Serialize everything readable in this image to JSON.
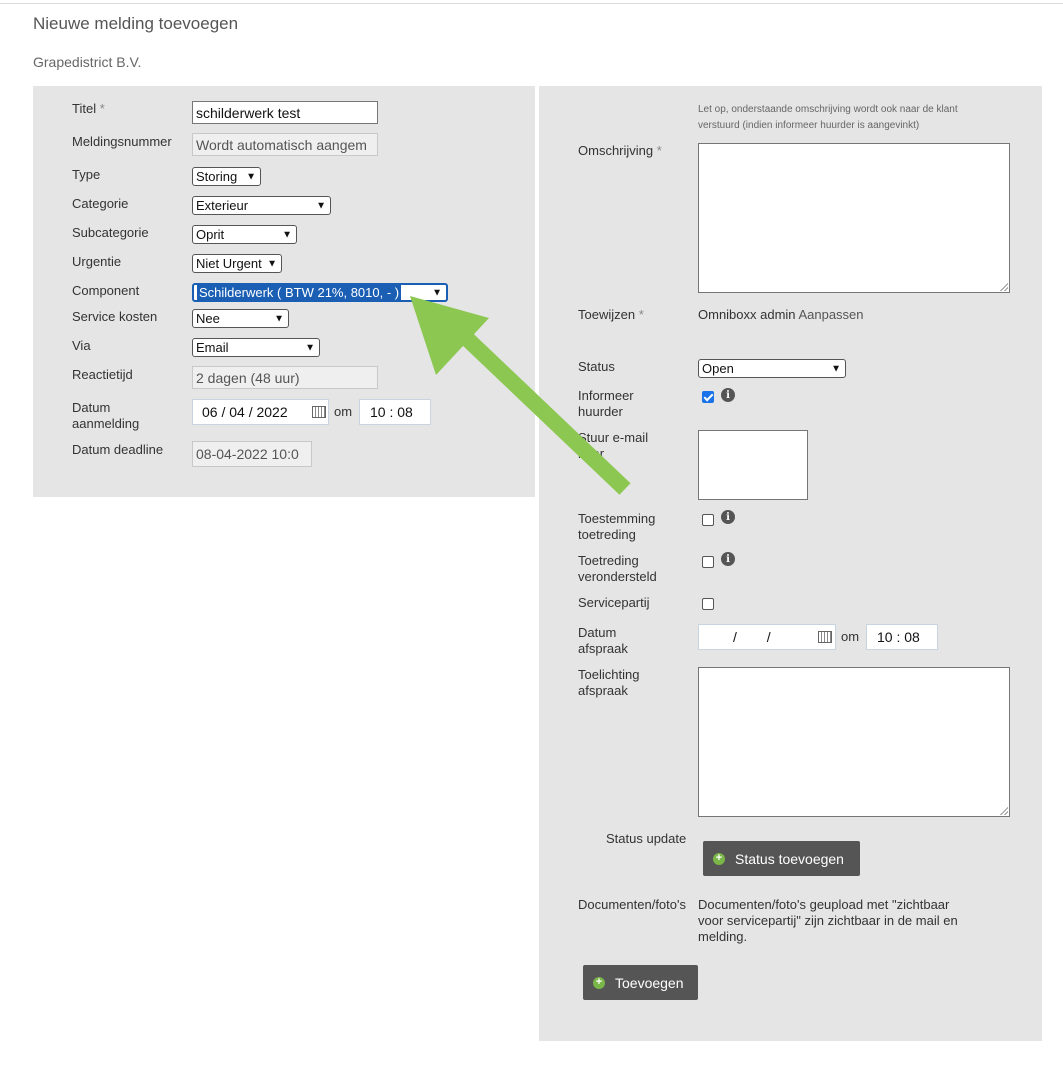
{
  "page": {
    "title": "Nieuwe melding toevoegen",
    "company": "Grapedistrict B.V."
  },
  "form": {
    "titel": {
      "label": "Titel",
      "required": "*",
      "value": "schilderwerk test"
    },
    "meldingsnummer": {
      "label": "Meldingsnummer",
      "value": "Wordt automatisch aangem"
    },
    "type": {
      "label": "Type",
      "value": "Storing"
    },
    "categorie": {
      "label": "Categorie",
      "value": "Exterieur"
    },
    "subcategorie": {
      "label": "Subcategorie",
      "value": "Oprit"
    },
    "urgentie": {
      "label": "Urgentie",
      "value": "Niet Urgent"
    },
    "component": {
      "label": "Component",
      "value": "Schilderwerk ( BTW 21%, 8010, - )"
    },
    "service_kosten": {
      "label": "Service kosten",
      "value": "Nee"
    },
    "via": {
      "label": "Via",
      "value": "Email"
    },
    "reactietijd": {
      "label": "Reactietijd",
      "value": "2 dagen (48 uur)"
    },
    "datum_aanmelding": {
      "label_1": "Datum",
      "label_2": "aanmelding",
      "date": "06 / 04 / 2022",
      "om": "om",
      "time": "10 : 08"
    },
    "datum_deadline": {
      "label": "Datum deadline",
      "value": "08-04-2022 10:0"
    }
  },
  "right": {
    "notice": "Let op, onderstaande omschrijving wordt ook naar de klant verstuurd (indien informeer huurder is aangevinkt)",
    "omschrijving": {
      "label": "Omschrijving",
      "required": "*"
    },
    "toewijzen": {
      "label": "Toewijzen",
      "required": "*",
      "value": "Omniboxx admin",
      "link": "Aanpassen"
    },
    "status": {
      "label": "Status",
      "value": "Open"
    },
    "informeer_huurder": {
      "label_1": "Informeer",
      "label_2": "huurder",
      "checked": true
    },
    "stuur_email": {
      "label_1": "Stuur e-mail",
      "label_2": "naar"
    },
    "toestemming": {
      "label_1": "Toestemming",
      "label_2": "toetreding",
      "checked": false
    },
    "toetreding": {
      "label_1": "Toetreding",
      "label_2": "verondersteld",
      "checked": false
    },
    "servicepartij": {
      "label": "Servicepartij",
      "checked": false
    },
    "datum_afspraak": {
      "label_1": "Datum",
      "label_2": "afspraak",
      "date": "/ /",
      "om": "om",
      "time": "10 : 08"
    },
    "toelichting": {
      "label_1": "Toelichting",
      "label_2": "afspraak"
    },
    "status_update": {
      "label": "Status update",
      "button": "Status toevoegen"
    },
    "documenten": {
      "label": "Documenten/foto's",
      "text": "Documenten/foto's geupload met \"zichtbaar voor servicepartij\" zijn zichtbaar in de mail en melding.",
      "button": "Toevoegen"
    }
  },
  "colors": {
    "panel": "#e5e5e5",
    "button": "#555555",
    "arrow": "#8cc751",
    "plus": "#7ab648"
  }
}
